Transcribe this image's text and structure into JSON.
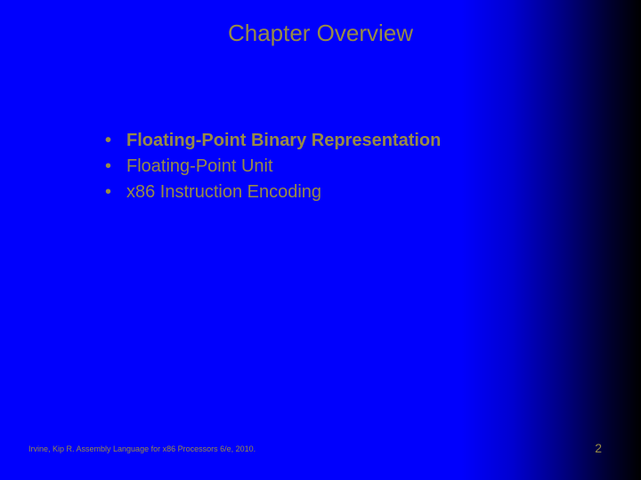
{
  "title": "Chapter Overview",
  "bullets": [
    {
      "text": "Floating-Point Binary Representation",
      "bold": true
    },
    {
      "text": "Floating-Point Unit",
      "bold": false
    },
    {
      "text": "x86 Instruction Encoding",
      "bold": false
    }
  ],
  "footer": "Irvine, Kip R. Assembly Language for x86 Processors 6/e, 2010.",
  "page_number": "2"
}
